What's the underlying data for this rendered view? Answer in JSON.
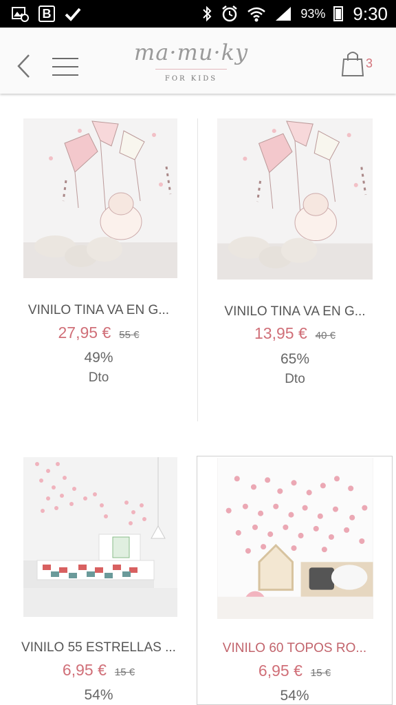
{
  "status_bar": {
    "battery": "93%",
    "time": "9:30",
    "b_app_letter": "B"
  },
  "header": {
    "logo_main": "ma·mu·ky",
    "logo_sub": "FOR KIDS",
    "cart_count": "3"
  },
  "products": [
    {
      "title": "VINILO TINA VA EN G...",
      "price": "27,95 €",
      "old_price": "55 €",
      "discount": "49%",
      "dto_label": "Dto",
      "image": "kites-elephant-mural"
    },
    {
      "title": "VINILO TINA VA EN G...",
      "price": "13,95 €",
      "old_price": "40 €",
      "discount": "65%",
      "dto_label": "Dto",
      "image": "kites-elephant-mural"
    },
    {
      "title": "VINILO 55 ESTRELLAS ...",
      "price": "6,95 €",
      "old_price": "15 €",
      "discount": "54%",
      "image": "pink-stars-bedroom"
    },
    {
      "title": "VINILO 60 TOPOS RO...",
      "price": "6,95 €",
      "old_price": "15 €",
      "discount": "54%",
      "image": "pink-dots-bedroom"
    }
  ],
  "colors": {
    "accent": "#d06f78",
    "header_bg": "#fafafa",
    "status_bar": "#000000"
  }
}
